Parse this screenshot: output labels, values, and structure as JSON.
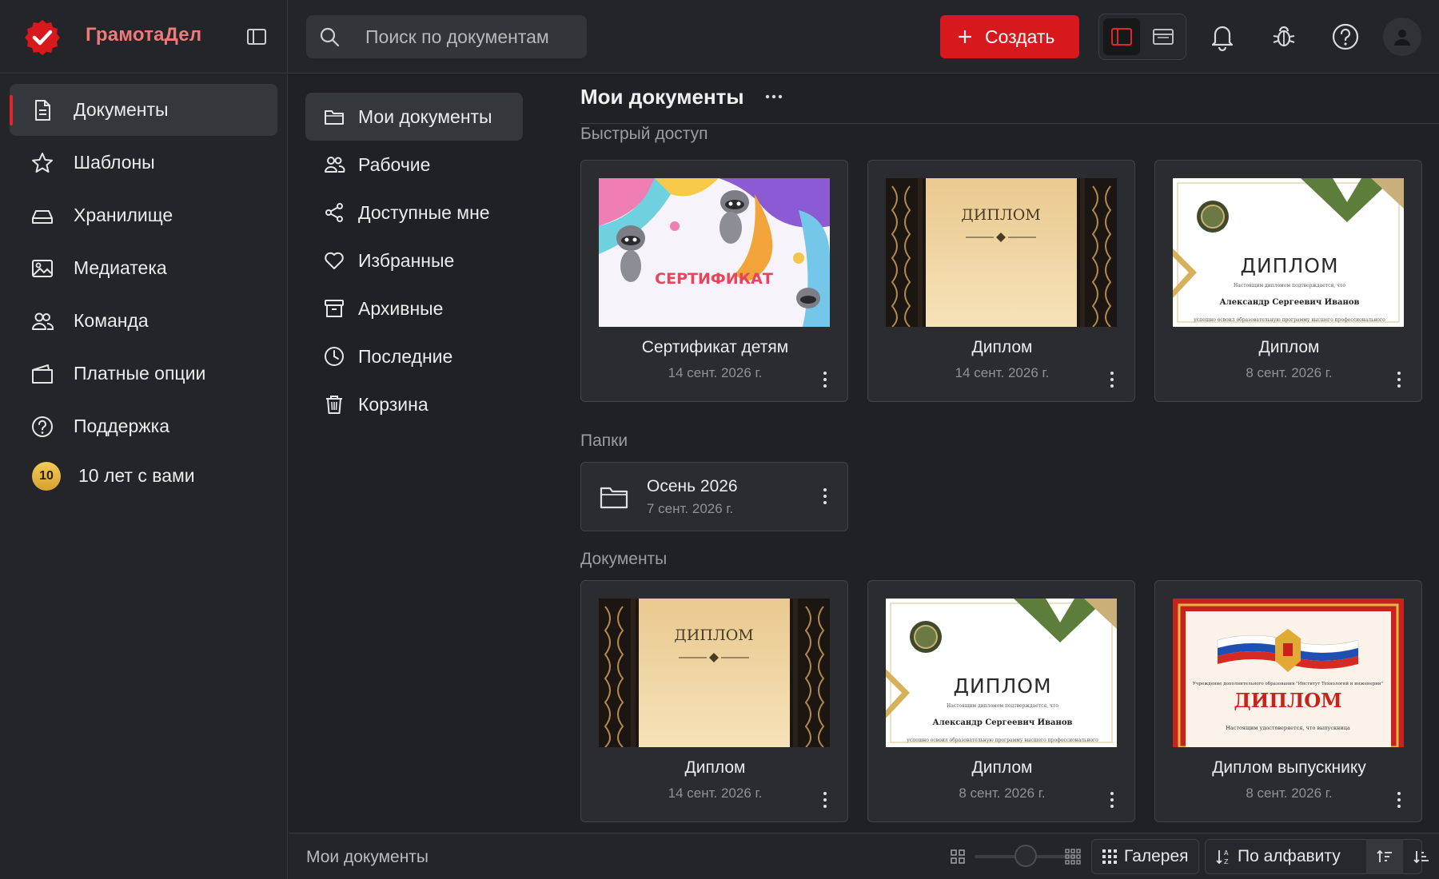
{
  "colors": {
    "accent": "#d7191d",
    "brand_text": "#f07a7a",
    "bg": "#1f2124",
    "panel": "#232528",
    "card": "#2a2c30"
  },
  "app": {
    "name": "ГрамотаДел"
  },
  "search": {
    "placeholder": "Поиск по документам"
  },
  "header": {
    "create_label": "Создать"
  },
  "sidebar": {
    "items": [
      {
        "label": "Документы",
        "icon": "document-icon",
        "active": true
      },
      {
        "label": "Шаблоны",
        "icon": "star-icon"
      },
      {
        "label": "Хранилище",
        "icon": "storage-icon"
      },
      {
        "label": "Медиатека",
        "icon": "media-icon"
      },
      {
        "label": "Команда",
        "icon": "team-icon"
      },
      {
        "label": "Платные опции",
        "icon": "wallet-icon"
      },
      {
        "label": "Поддержка",
        "icon": "help-icon"
      }
    ],
    "anniversary": {
      "badge": "10",
      "label": "10 лет с вами"
    }
  },
  "subnav": {
    "items": [
      {
        "label": "Мои документы",
        "icon": "folder-icon",
        "active": true
      },
      {
        "label": "Рабочие",
        "icon": "users-icon"
      },
      {
        "label": "Доступные мне",
        "icon": "share-icon"
      },
      {
        "label": "Избранные",
        "icon": "heart-icon"
      },
      {
        "label": "Архивные",
        "icon": "archive-icon"
      },
      {
        "label": "Последние",
        "icon": "clock-icon"
      },
      {
        "label": "Корзина",
        "icon": "trash-icon"
      }
    ]
  },
  "main": {
    "title": "Мои документы",
    "quick_access_label": "Быстрый доступ",
    "folders_label": "Папки",
    "documents_label": "Документы",
    "quick_access": [
      {
        "name": "Сертификат детям",
        "date": "14 сент. 2026 г.",
        "thumb_text": "СЕРТИФИКАТ"
      },
      {
        "name": "Диплом",
        "date": "14 сент. 2026 г.",
        "thumb_text": "ДИПЛОМ"
      },
      {
        "name": "Диплом",
        "date": "8 сент. 2026 г.",
        "thumb_text": "ДИПЛОМ",
        "thumb_sub": "Настоящим дипломом подтверждается, что",
        "thumb_person": "Александр Сергеевич Иванов",
        "thumb_line": "успешно освоил образовательную программу высшего профессионального"
      }
    ],
    "folders": [
      {
        "name": "Осень 2026",
        "date": "7 сент. 2026 г."
      }
    ],
    "documents": [
      {
        "name": "Диплом",
        "date": "14 сент. 2026 г.",
        "thumb_text": "ДИПЛОМ"
      },
      {
        "name": "Диплом",
        "date": "8 сент. 2026 г.",
        "thumb_text": "ДИПЛОМ",
        "thumb_sub": "Настоящим дипломом подтверждается, что",
        "thumb_person": "Александр Сергеевич Иванов",
        "thumb_line": "успешно освоил образовательную программу высшего профессионального"
      },
      {
        "name": "Диплом выпускнику",
        "date": "8 сент. 2026 г.",
        "thumb_text": "ДИПЛОМ",
        "thumb_org": "Учреждение дополнительного образования \"Институт Технологий и инженерии\"",
        "thumb_sub": "Настоящим удостоверяется, что выпускница"
      }
    ]
  },
  "statusbar": {
    "path": "Мои документы",
    "zoom_level": 0.5,
    "view_label": "Галерея",
    "sort_label": "По алфавиту"
  }
}
